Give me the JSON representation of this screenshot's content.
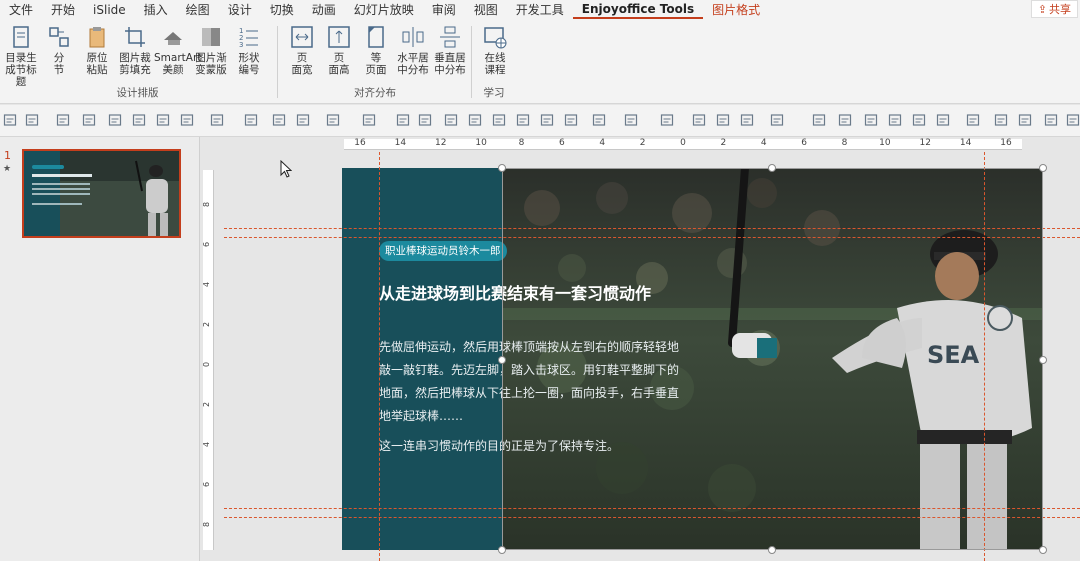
{
  "menubar": {
    "items": [
      "文件",
      "开始",
      "iSlide",
      "插入",
      "绘图",
      "设计",
      "切换",
      "动画",
      "幻灯片放映",
      "审阅",
      "视图",
      "开发工具",
      "Enjoyoffice Tools",
      "图片格式"
    ],
    "active_label": "Enjoyoffice Tools",
    "accent_label": "图片格式",
    "share_label": "共享"
  },
  "ribbon": {
    "group1": {
      "label": "设计排版",
      "buttons": [
        {
          "line1": "目录生",
          "line2": "成节标题",
          "icon": "toc-icon"
        },
        {
          "line1": "分",
          "line2": "节",
          "icon": "section-icon"
        },
        {
          "line1": "原位",
          "line2": "粘贴",
          "icon": "paste-icon"
        },
        {
          "line1": "图片裁",
          "line2": "剪填充",
          "icon": "crop-icon"
        },
        {
          "line1": "SmartArt",
          "line2": "美颜",
          "icon": "smartart-icon"
        },
        {
          "line1": "图片渐",
          "line2": "变蒙版",
          "icon": "gradient-icon"
        },
        {
          "line1": "形状",
          "line2": "编号",
          "icon": "numbering-icon"
        }
      ]
    },
    "group2": {
      "label": "对齐分布",
      "buttons": [
        {
          "line1": "页",
          "line2": "面宽",
          "icon": "page-width-icon"
        },
        {
          "line1": "页",
          "line2": "面高",
          "icon": "page-height-icon"
        },
        {
          "line1": "等",
          "line2": "页面",
          "icon": "equal-page-icon"
        },
        {
          "line1": "水平居",
          "line2": "中分布",
          "icon": "h-distribute-icon"
        },
        {
          "line1": "垂直居",
          "line2": "中分布",
          "icon": "v-distribute-icon"
        }
      ]
    },
    "group3": {
      "label": "学习",
      "buttons": [
        {
          "line1": "在线",
          "line2": "课程",
          "icon": "online-course-icon"
        }
      ]
    }
  },
  "thumbnails": {
    "slide_number": "1",
    "star": "★"
  },
  "ruler": {
    "h_labels": [
      "16",
      "14",
      "12",
      "10",
      "8",
      "6",
      "4",
      "2",
      "0",
      "2",
      "4",
      "6",
      "8",
      "10",
      "12",
      "14",
      "16"
    ],
    "v_labels": [
      "8",
      "6",
      "4",
      "2",
      "0",
      "2",
      "4",
      "6",
      "8"
    ]
  },
  "slide": {
    "badge": "职业棒球运动员铃木一郎",
    "headline": "从走进球场到比赛结束有一套习惯动作",
    "body": "先做屈伸运动，然后用球棒顶端按从左到右的顺序轻轻地敲一敲钉鞋。先迈左脚，踏入击球区。用钉鞋平整脚下的地面，然后把棒球从下往上抡一圈，面向投手，右手垂直地举起球棒……",
    "body2": "这一连串习惯动作的目的正是为了保持专注。",
    "colors": {
      "panel": "#184f5a",
      "badge": "#1c8a9e",
      "guide": "#d9572e"
    }
  },
  "colors": {
    "accent": "#c43e1c",
    "chrome": "#f3f3f3"
  }
}
